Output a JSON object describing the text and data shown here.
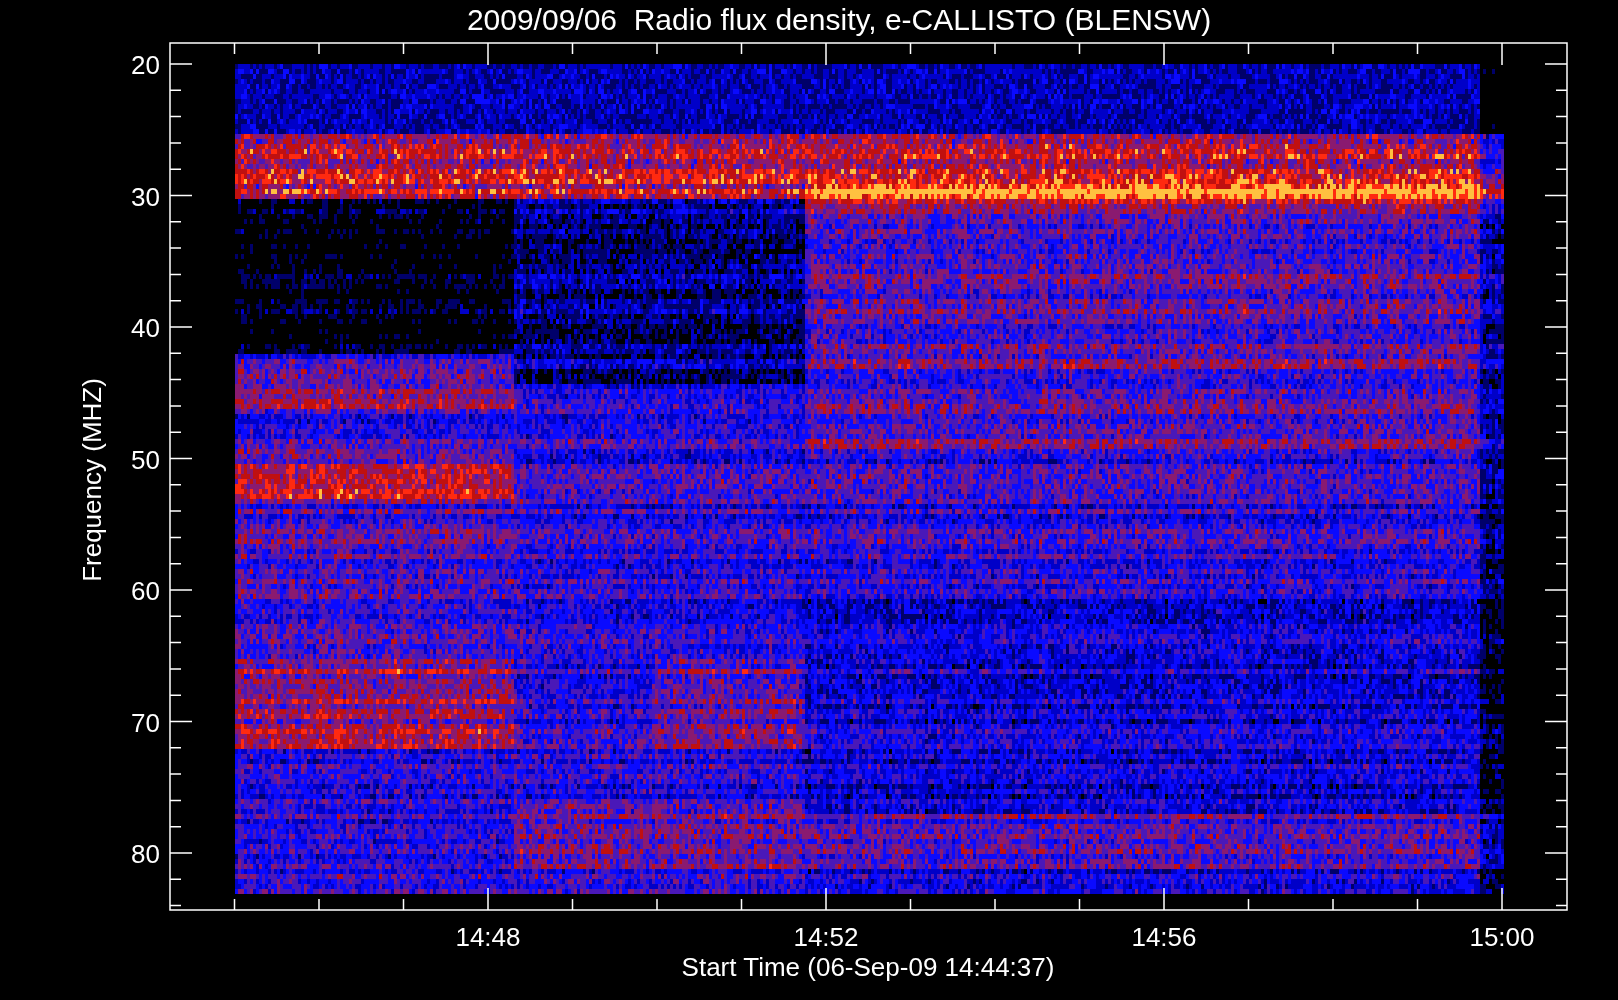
{
  "title": "2009/09/06  Radio flux density, e-CALLISTO (BLENSW)",
  "ylabel": "Frequency (MHZ)",
  "xlabel": "Start Time (06-Sep-09 14:44:37)",
  "yticks": [
    "20",
    "30",
    "40",
    "50",
    "60",
    "70",
    "80"
  ],
  "xticks": [
    "14:48",
    "14:52",
    "14:56",
    "15:00"
  ]
}
